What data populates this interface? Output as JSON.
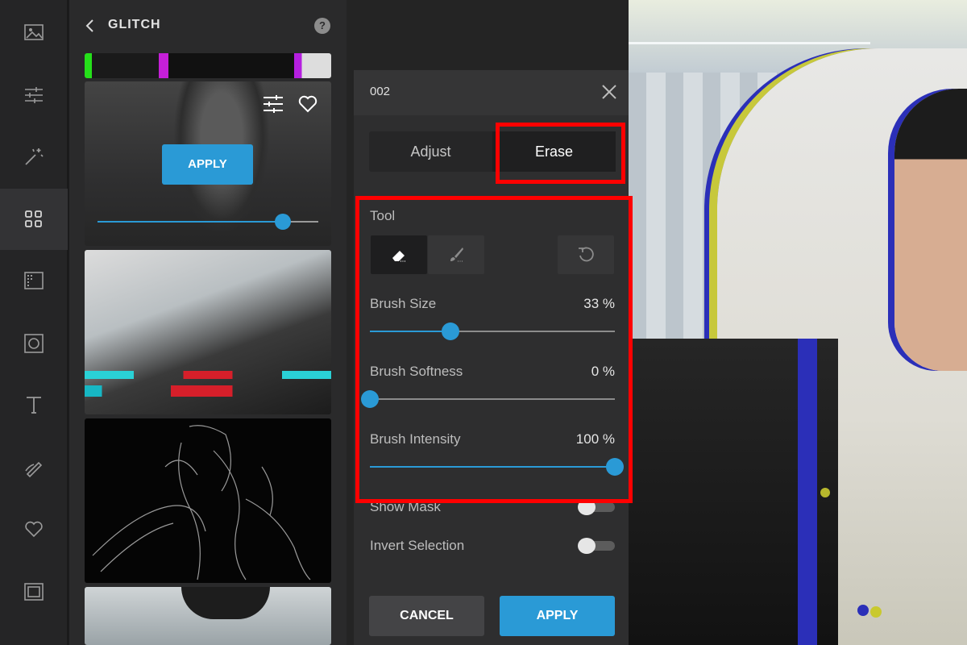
{
  "colors": {
    "accent": "#2a9ad6",
    "highlight": "#ff0000",
    "panel": "#2e2e2f",
    "rail": "#252526"
  },
  "rail": {
    "items": [
      {
        "icon": "image-icon"
      },
      {
        "icon": "sliders-icon"
      },
      {
        "icon": "magic-wand-icon"
      },
      {
        "icon": "effects-grid-icon",
        "active": true
      },
      {
        "icon": "texture-icon"
      },
      {
        "icon": "frame-icon"
      },
      {
        "icon": "text-icon"
      },
      {
        "icon": "draw-icon"
      },
      {
        "icon": "heart-icon"
      },
      {
        "icon": "border-icon"
      }
    ]
  },
  "fx_panel": {
    "title": "GLITCH",
    "help": "?",
    "active_thumb": {
      "apply_label": "APPLY",
      "intensity": 0.84
    }
  },
  "props": {
    "title": "002",
    "tabs": [
      "Adjust",
      "Erase"
    ],
    "active_tab": "Erase",
    "tool_label": "Tool",
    "tools": [
      "eraser-icon",
      "brush-icon"
    ],
    "reset_icon": "undo-icon",
    "sliders": [
      {
        "label": "Brush Size",
        "value_text": "33 %",
        "value": 33
      },
      {
        "label": "Brush Softness",
        "value_text": "0 %",
        "value": 0
      },
      {
        "label": "Brush Intensity",
        "value_text": "100 %",
        "value": 100
      }
    ],
    "toggles": [
      {
        "label": "Show Mask",
        "on": false
      },
      {
        "label": "Invert Selection",
        "on": false
      }
    ],
    "cancel_label": "CANCEL",
    "apply_label": "APPLY"
  }
}
